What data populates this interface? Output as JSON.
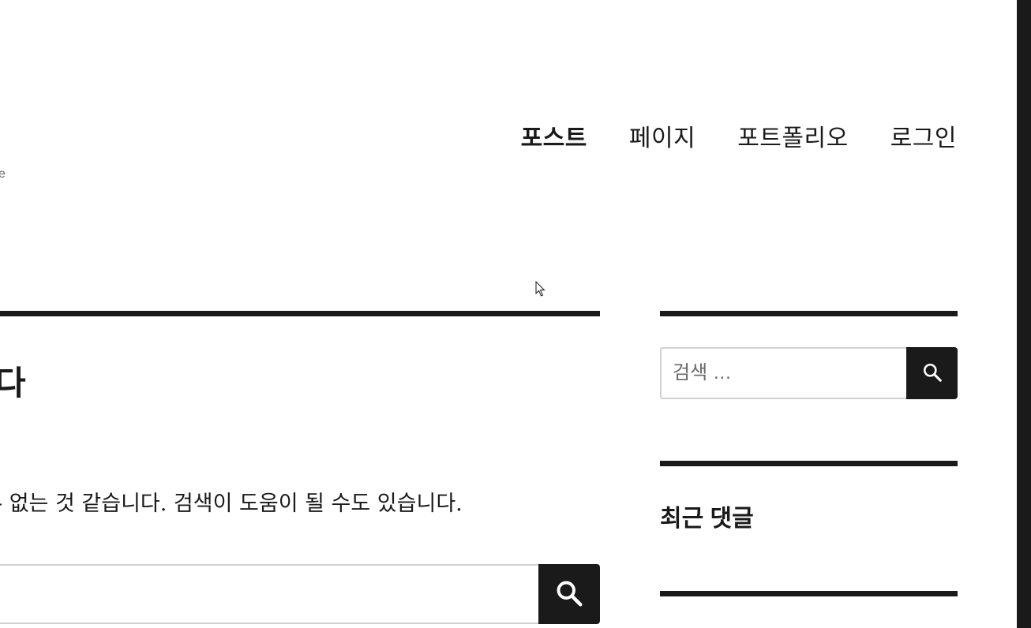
{
  "header": {
    "site_description_fragment": "e"
  },
  "nav": {
    "items": [
      {
        "label": "포스트",
        "current": true
      },
      {
        "label": "페이지",
        "current": false
      },
      {
        "label": "포트폴리오",
        "current": false
      },
      {
        "label": "로그인",
        "current": false
      }
    ]
  },
  "main": {
    "title_fragment": "다",
    "notice_text": "- 없는 것 같습니다. 검색이 도움이 될 수도 있습니다."
  },
  "sidebar": {
    "search_placeholder": "검색 …",
    "recent_comments_title": "최근 댓글"
  },
  "colors": {
    "text": "#1a1a1a",
    "border": "#d1d1d1",
    "muted": "#686868",
    "background": "#ffffff"
  },
  "icons": {
    "search_button": "search-icon",
    "cursor": "mouse-pointer-icon"
  }
}
